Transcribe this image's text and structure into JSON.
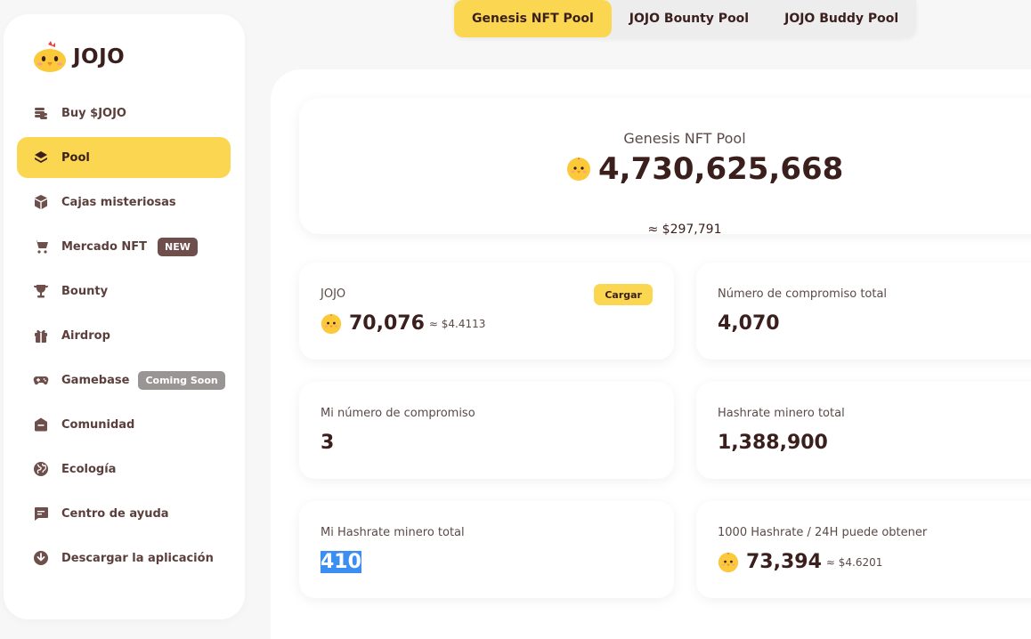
{
  "brand": {
    "name": "JOJO"
  },
  "nav": {
    "items": [
      {
        "label": "Buy $JOJO",
        "icon": "coins-stack-icon"
      },
      {
        "label": "Pool",
        "icon": "layers-icon",
        "active": true
      },
      {
        "label": "Cajas misteriosas",
        "icon": "box-icon"
      },
      {
        "label": "Mercado NFT",
        "icon": "cart-icon",
        "badge": "NEW"
      },
      {
        "label": "Bounty",
        "icon": "trophy-icon"
      },
      {
        "label": "Airdrop",
        "icon": "gift-icon"
      },
      {
        "label": "Gamebase",
        "icon": "gamepad-icon",
        "badge": "Coming Soon"
      },
      {
        "label": "Comunidad",
        "icon": "community-icon"
      },
      {
        "label": "Ecología",
        "icon": "globe-icon"
      },
      {
        "label": "Centro de ayuda",
        "icon": "chat-icon"
      },
      {
        "label": "Descargar la aplicación",
        "icon": "download-icon"
      }
    ]
  },
  "tabs": [
    {
      "label": "Genesis NFT Pool",
      "active": true
    },
    {
      "label": "JOJO Bounty Pool"
    },
    {
      "label": "JOJO Buddy Pool"
    }
  ],
  "hero": {
    "title": "Genesis NFT Pool",
    "amount": "4,730,625,668",
    "usd": "≈ $297,791"
  },
  "cards": {
    "jojo": {
      "label": "JOJO",
      "value": "70,076",
      "usd": "≈ $4.4113",
      "button": "Cargar"
    },
    "total_stake": {
      "label": "Número de compromiso total",
      "value": "4,070"
    },
    "my_stake": {
      "label": "Mi número de compromiso",
      "value": "3"
    },
    "total_hashrate": {
      "label": "Hashrate minero total",
      "value": "1,388,900"
    },
    "my_hashrate": {
      "label": "Mi Hashrate minero total",
      "value": "410"
    },
    "reward": {
      "label": "1000 Hashrate / 24H puede obtener",
      "value": "73,394",
      "usd": "≈ $4.6201"
    }
  },
  "colors": {
    "accent": "#fbd650",
    "text": "#3a1f1d",
    "badge_new": "#6e4f4b",
    "badge_soon": "#9a9595"
  }
}
